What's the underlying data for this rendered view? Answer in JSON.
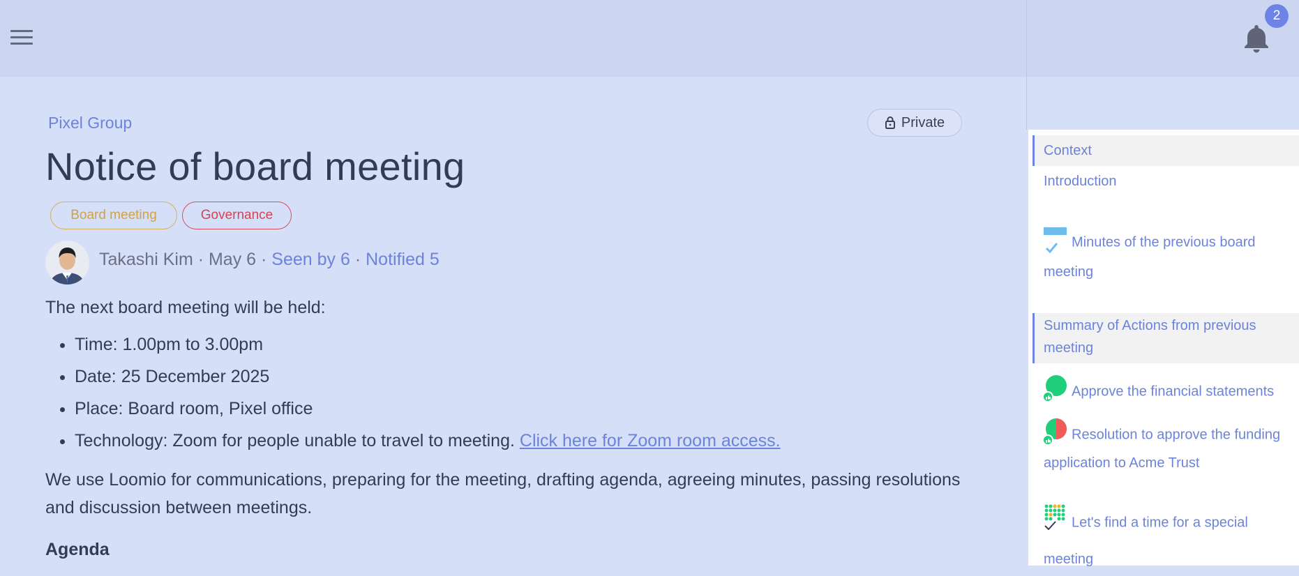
{
  "header": {
    "menu_icon": "hamburger-menu-icon",
    "notification_icon": "bell-icon",
    "notification_count": "2"
  },
  "thread": {
    "group": "Pixel Group",
    "privacy_label": "Private",
    "privacy_icon": "lock-icon",
    "title": "Notice of board meeting",
    "tags": [
      "Board meeting",
      "Governance"
    ],
    "author": "Takashi Kim",
    "sep1": " · ",
    "date": "May 6",
    "sep2": " · ",
    "seen": "Seen by 6",
    "sep3": " · ",
    "notified": "Notified 5",
    "intro": "The next board meeting will be held:",
    "details": [
      "Time: 1.00pm to 3.00pm",
      "Date: 25 December 2025",
      "Place: Board room, Pixel office",
      "Technology: Zoom for people unable to travel to meeting. "
    ],
    "zoom_link": "Click here for Zoom room access.",
    "paragraph": "We use Loomio for communications, preparing for the meeting, drafting agenda, agreeing minutes, passing resolutions and discussion between meetings.",
    "agenda_heading": "Agenda"
  },
  "toc": {
    "items": [
      "Context",
      "Introduction",
      "Minutes of the previous board meeting",
      "Summary of Actions from previous meeting",
      "Approve the financial statements",
      "Resolution to approve the funding application to Acme Trust",
      "Let's find a time for a special meeting"
    ],
    "colors": {
      "accent": "#6d83e6",
      "link": "#6b83d9",
      "agree": "#1fcf7b",
      "disagree": "#f05a5a"
    }
  }
}
